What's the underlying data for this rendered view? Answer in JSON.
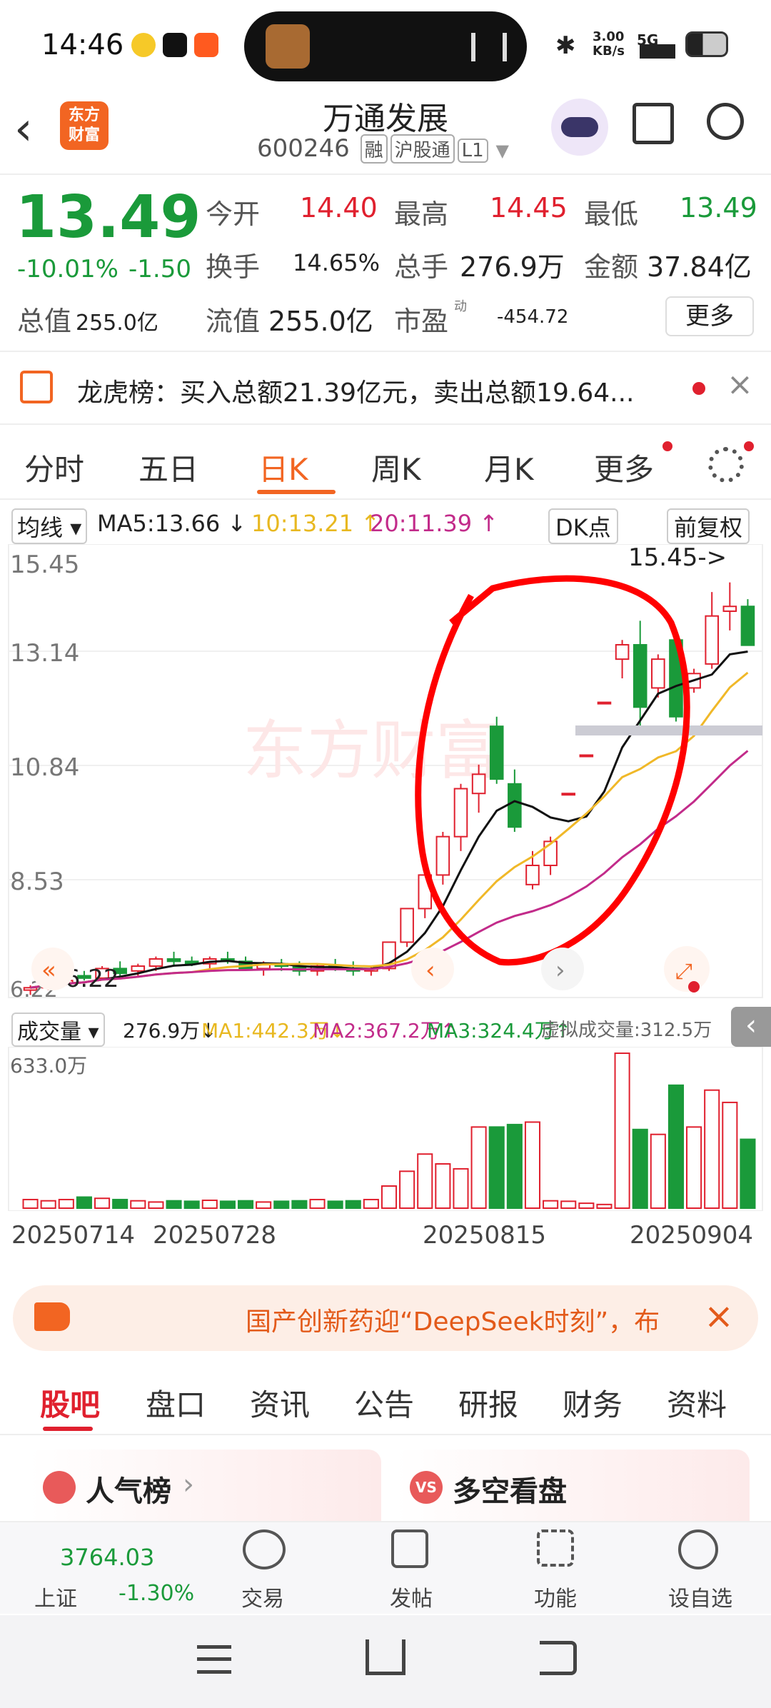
{
  "status_bar": {
    "time": "14:46",
    "speed": "3.00\nKB/s",
    "network": "5G"
  },
  "header": {
    "logo": "东方\n财富",
    "title": "万通发展",
    "code": "600246",
    "tags": [
      "融",
      "沪股通",
      "L1"
    ]
  },
  "quote": {
    "price": "13.49",
    "change_pct": "-10.01%",
    "change": "-1.50",
    "open_label": "今开",
    "open": "14.40",
    "high_label": "最高",
    "high": "14.45",
    "low_label": "最低",
    "low": "13.49",
    "turnover_label": "换手",
    "turnover": "14.65%",
    "volume_label": "总手",
    "volume": "276.9万",
    "amount_label": "金额",
    "amount": "37.84亿",
    "mktcap_label": "总值",
    "mktcap": "255.0亿",
    "float_label": "流值",
    "float": "255.0亿",
    "pe_label": "市盈",
    "pe_sup": "动",
    "pe": "-454.72",
    "more": "更多"
  },
  "notice": {
    "text": "龙虎榜：买入总额21.39亿元，卖出总额19.64..."
  },
  "tabs": [
    "分时",
    "五日",
    "日K",
    "周K",
    "月K",
    "更多"
  ],
  "chart_header": {
    "ma_select": "均线",
    "ma5": "MA5:13.66 ↓",
    "ma10": "10:13.21 ↑",
    "ma20": "20:11.39 ↑",
    "dk": "DK点",
    "fq": "前复权"
  },
  "chart_labels": {
    "y1": "15.45",
    "y2": "13.14",
    "y3": "10.84",
    "y4": "8.53",
    "y5": "6.22",
    "max_note": "15.45->",
    "min_note": "<-6.22"
  },
  "volume_header": {
    "select": "成交量",
    "vol": "276.9万↓",
    "ma1": "MA1:442.3万↓",
    "ma2": "MA2:367.2万↑",
    "ma3": "MA3:324.4万↑",
    "virtual": "虚拟成交量:312.5万",
    "max": "633.0万"
  },
  "dates": [
    "20250714",
    "20250728",
    "20250815",
    "20250904"
  ],
  "ad": {
    "text": "国产创新药迎“DeepSeek时刻”，布"
  },
  "section_tabs": [
    "股吧",
    "盘口",
    "资讯",
    "公告",
    "研报",
    "财务",
    "资料"
  ],
  "cards": [
    {
      "label": "人气榜"
    },
    {
      "label": "多空看盘"
    }
  ],
  "bottom_nav": {
    "index_value": "3764.03",
    "index_name": "上证",
    "index_change": "-1.30%",
    "items": [
      "交易",
      "发帖",
      "功能",
      "设自选"
    ]
  },
  "colors": {
    "up": "#e0202e",
    "down": "#1a9a3a",
    "accent": "#f26522"
  },
  "chart_data": {
    "type": "candlestick",
    "ylim": [
      6.22,
      15.45
    ],
    "candles": [
      [
        6.3,
        6.4,
        6.2,
        6.35
      ],
      [
        6.35,
        6.5,
        6.3,
        6.45
      ],
      [
        6.45,
        6.6,
        6.4,
        6.5
      ],
      [
        6.6,
        6.7,
        6.5,
        6.55
      ],
      [
        6.55,
        6.8,
        6.5,
        6.75
      ],
      [
        6.75,
        6.9,
        6.6,
        6.65
      ],
      [
        6.7,
        6.85,
        6.6,
        6.8
      ],
      [
        6.8,
        7.0,
        6.7,
        6.95
      ],
      [
        6.95,
        7.1,
        6.8,
        6.9
      ],
      [
        6.9,
        7.0,
        6.8,
        6.85
      ],
      [
        6.85,
        7.0,
        6.75,
        6.95
      ],
      [
        6.95,
        7.1,
        6.85,
        6.9
      ],
      [
        6.9,
        7.0,
        6.7,
        6.75
      ],
      [
        6.75,
        6.9,
        6.6,
        6.85
      ],
      [
        6.85,
        6.95,
        6.7,
        6.8
      ],
      [
        6.8,
        6.9,
        6.6,
        6.7
      ],
      [
        6.7,
        6.85,
        6.6,
        6.8
      ],
      [
        6.8,
        6.95,
        6.7,
        6.75
      ],
      [
        6.75,
        6.9,
        6.6,
        6.7
      ],
      [
        6.7,
        6.8,
        6.6,
        6.75
      ],
      [
        6.75,
        7.3,
        6.7,
        7.3
      ],
      [
        7.3,
        8.0,
        7.2,
        8.0
      ],
      [
        8.0,
        8.8,
        7.8,
        8.7
      ],
      [
        8.7,
        9.6,
        8.5,
        9.5
      ],
      [
        9.5,
        10.6,
        9.2,
        10.5
      ],
      [
        10.4,
        11.0,
        10.0,
        10.8
      ],
      [
        11.8,
        12.0,
        10.6,
        10.7
      ],
      [
        10.6,
        10.9,
        9.6,
        9.7
      ],
      [
        8.5,
        9.2,
        8.4,
        8.9
      ],
      [
        8.9,
        9.5,
        8.7,
        9.4
      ],
      [
        10.4,
        10.4,
        10.4,
        10.4
      ],
      [
        11.2,
        11.2,
        11.2,
        11.2
      ],
      [
        12.3,
        12.3,
        12.3,
        12.3
      ],
      [
        13.2,
        13.6,
        12.8,
        13.5
      ],
      [
        13.5,
        14.0,
        11.8,
        12.2
      ],
      [
        12.6,
        13.3,
        12.4,
        13.2
      ],
      [
        13.6,
        13.7,
        11.9,
        12.0
      ],
      [
        12.6,
        13.0,
        12.5,
        12.9
      ],
      [
        13.1,
        14.6,
        13.0,
        14.1
      ],
      [
        14.2,
        14.8,
        13.8,
        14.3
      ],
      [
        14.3,
        14.45,
        13.49,
        13.49
      ]
    ],
    "volume_max": 633.0,
    "volumes": [
      35,
      30,
      35,
      45,
      40,
      35,
      30,
      25,
      30,
      28,
      32,
      28,
      30,
      25,
      28,
      30,
      35,
      28,
      30,
      35,
      90,
      150,
      220,
      180,
      160,
      330,
      330,
      340,
      350,
      30,
      28,
      20,
      15,
      630,
      320,
      300,
      500,
      330,
      480,
      430,
      280
    ]
  }
}
